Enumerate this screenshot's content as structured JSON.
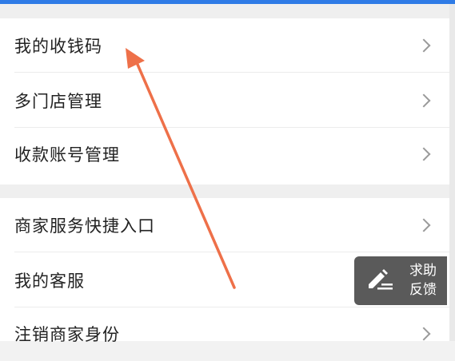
{
  "group_one": {
    "items": [
      {
        "label": "我的收钱码"
      },
      {
        "label": "多门店管理"
      },
      {
        "label": "收款账号管理"
      }
    ]
  },
  "group_two": {
    "items": [
      {
        "label": "商家服务快捷入口"
      },
      {
        "label": "我的客服"
      },
      {
        "label": "注销商家身份"
      }
    ]
  },
  "feedback": {
    "line1": "求助",
    "line2": "反馈",
    "icon": "edit-pen-icon"
  },
  "annotation": {
    "icon": "red-arrow-annotation",
    "color": "#ee7049"
  },
  "colors": {
    "accent_top": "#2f7be6",
    "background": "#f2f2f2",
    "row_bg": "#ffffff"
  }
}
